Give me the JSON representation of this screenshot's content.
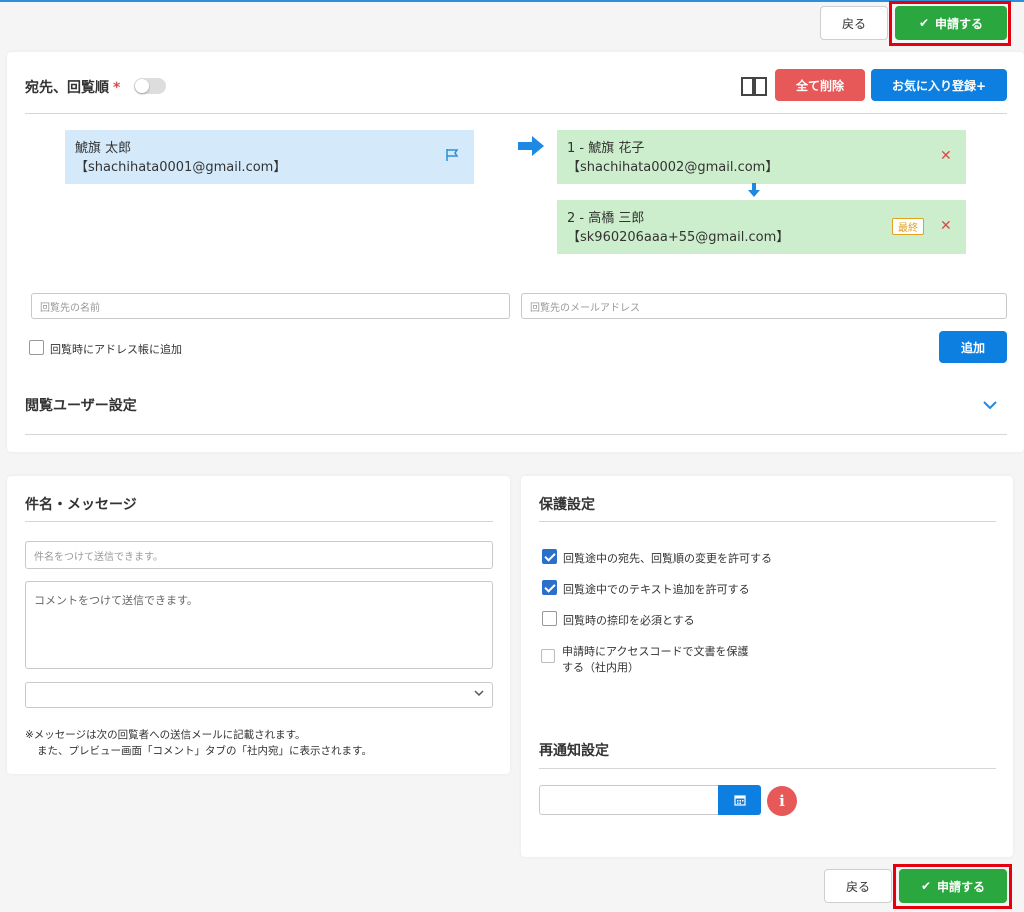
{
  "header": {
    "back_label": "戻る",
    "apply_label": "申請する"
  },
  "recipients": {
    "title": "宛先、回覧順",
    "required_mark": "*",
    "delete_all_label": "全て削除",
    "favorite_label": "お気に入り登録+",
    "sender": {
      "name": "鯱旗 太郎",
      "email": "【shachihata0001@gmail.com】"
    },
    "list": [
      {
        "label": "1 - 鯱旗 花子",
        "email": "【shachihata0002@gmail.com】"
      },
      {
        "label": "2 - 高橋 三郎",
        "email": "【sk960206aaa+55@gmail.com】",
        "badge": "最終"
      }
    ],
    "name_placeholder": "回覧先の名前",
    "email_placeholder": "回覧先のメールアドレス",
    "add_to_addressbook_label": "回覧時にアドレス帳に追加",
    "add_label": "追加",
    "viewer_settings_label": "閲覧ユーザー設定"
  },
  "message": {
    "title": "件名・メッセージ",
    "subject_placeholder": "件名をつけて送信できます。",
    "comment_placeholder": "コメントをつけて送信できます。",
    "note_line1": "※メッセージは次の回覧者への送信メールに記載されます。",
    "note_line2": "また、プレビュー画面「コメント」タブの「社内宛」に表示されます。"
  },
  "protection": {
    "title": "保護設定",
    "options": [
      {
        "label": "回覧途中の宛先、回覧順の変更を許可する",
        "checked": true
      },
      {
        "label": "回覧途中でのテキスト追加を許可する",
        "checked": true
      },
      {
        "label": "回覧時の捺印を必須とする",
        "checked": false
      },
      {
        "label_line1": "申請時にアクセスコードで文書を保護",
        "label_line2": "する（社内用）",
        "checked": false
      }
    ],
    "renotify_title": "再通知設定"
  },
  "footer": {
    "back_label": "戻る",
    "apply_label": "申請する"
  },
  "colors": {
    "green": "#2aa83f",
    "red": "#e75858",
    "blue": "#0d7fe0",
    "highlight": "#e4000f"
  }
}
